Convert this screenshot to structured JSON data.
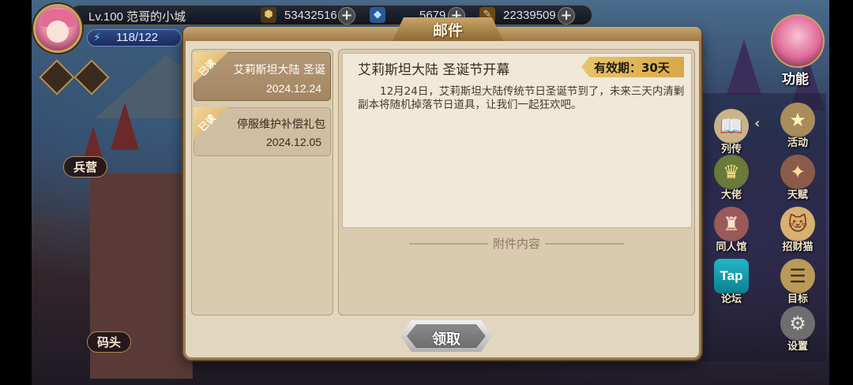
{
  "hud": {
    "level_name": "Lv.100  范哥的小城",
    "energy": "118/122",
    "currency_1": "53432516",
    "currency_2": "5679",
    "currency_3": "22339509",
    "plus": "+"
  },
  "scene_labels": {
    "barracks": "兵营",
    "dock": "码头"
  },
  "right_menu": {
    "function": "功能",
    "chevron": "‹",
    "items": [
      {
        "label": "列传",
        "icon": "book-icon"
      },
      {
        "label": "活动",
        "icon": "star-badge-icon"
      },
      {
        "label": "大佬",
        "icon": "crown-icon"
      },
      {
        "label": "天赋",
        "icon": "winged-emblem-icon"
      },
      {
        "label": "同人馆",
        "icon": "castle-icon"
      },
      {
        "label": "招财猫",
        "icon": "lucky-cat-icon"
      },
      {
        "label": "论坛",
        "icon": "taptap-icon",
        "icon_text": "Tap"
      },
      {
        "label": "目标",
        "icon": "target-scroll-icon"
      },
      {
        "label": "设置",
        "icon": "gear-icon"
      }
    ]
  },
  "dialog": {
    "title": "邮件",
    "read_tag": "已读",
    "mails": [
      {
        "title": "艾莉斯坦大陆 圣诞",
        "date": "2024.12.24",
        "selected": true
      },
      {
        "title": "停服维护补偿礼包",
        "date": "2024.12.05",
        "selected": false
      }
    ],
    "message": {
      "title": "艾莉斯坦大陆 圣诞节开幕",
      "validity": "有效期：30天",
      "body": "12月24日，艾莉斯坦大陆传统节日圣诞节到了，未来三天内清剿副本将随机掉落节日道具，让我们一起狂欢吧。"
    },
    "attachment_label": "附件内容",
    "claim_button": "领取"
  },
  "colors": {
    "dialog_bg": "#e3d6bf",
    "selected_mail": "#a38663",
    "validity_badge": "#e0b65a",
    "frame": "#9b7c52"
  }
}
